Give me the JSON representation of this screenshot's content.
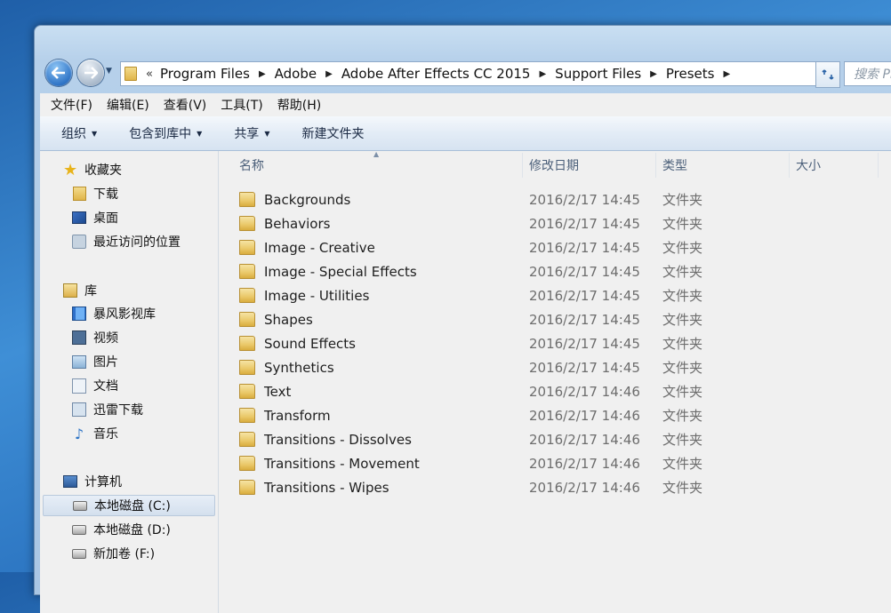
{
  "address": {
    "leading": "«",
    "crumbs": [
      "Program Files",
      "Adobe",
      "Adobe After Effects CC 2015",
      "Support Files",
      "Presets"
    ],
    "separator": "▶",
    "dropdown": "▾"
  },
  "search": {
    "placeholder": "搜索 Pr"
  },
  "menu": [
    "文件(F)",
    "编辑(E)",
    "查看(V)",
    "工具(T)",
    "帮助(H)"
  ],
  "toolbar": {
    "organize": "组织",
    "include_in_library": "包含到库中",
    "share": "共享",
    "new_folder": "新建文件夹"
  },
  "nav": {
    "favorites": {
      "label": "收藏夹",
      "items": [
        "下载",
        "桌面",
        "最近访问的位置"
      ]
    },
    "libraries": {
      "label": "库",
      "items": [
        "暴风影视库",
        "视频",
        "图片",
        "文档",
        "迅雷下载",
        "音乐"
      ]
    },
    "computer": {
      "label": "计算机",
      "items": [
        "本地磁盘 (C:)",
        "本地磁盘 (D:)",
        "新加卷 (F:)"
      ],
      "selected_index": 0
    }
  },
  "columns": {
    "name": "名称",
    "modified": "修改日期",
    "type": "类型",
    "size": "大小"
  },
  "files": [
    {
      "name": "Backgrounds",
      "date": "2016/2/17 14:45",
      "type": "文件夹"
    },
    {
      "name": "Behaviors",
      "date": "2016/2/17 14:45",
      "type": "文件夹"
    },
    {
      "name": "Image - Creative",
      "date": "2016/2/17 14:45",
      "type": "文件夹"
    },
    {
      "name": "Image - Special Effects",
      "date": "2016/2/17 14:45",
      "type": "文件夹"
    },
    {
      "name": "Image - Utilities",
      "date": "2016/2/17 14:45",
      "type": "文件夹"
    },
    {
      "name": "Shapes",
      "date": "2016/2/17 14:45",
      "type": "文件夹"
    },
    {
      "name": "Sound Effects",
      "date": "2016/2/17 14:45",
      "type": "文件夹"
    },
    {
      "name": "Synthetics",
      "date": "2016/2/17 14:45",
      "type": "文件夹"
    },
    {
      "name": "Text",
      "date": "2016/2/17 14:46",
      "type": "文件夹"
    },
    {
      "name": "Transform",
      "date": "2016/2/17 14:46",
      "type": "文件夹"
    },
    {
      "name": "Transitions - Dissolves",
      "date": "2016/2/17 14:46",
      "type": "文件夹"
    },
    {
      "name": "Transitions - Movement",
      "date": "2016/2/17 14:46",
      "type": "文件夹"
    },
    {
      "name": "Transitions - Wipes",
      "date": "2016/2/17 14:46",
      "type": "文件夹"
    }
  ]
}
